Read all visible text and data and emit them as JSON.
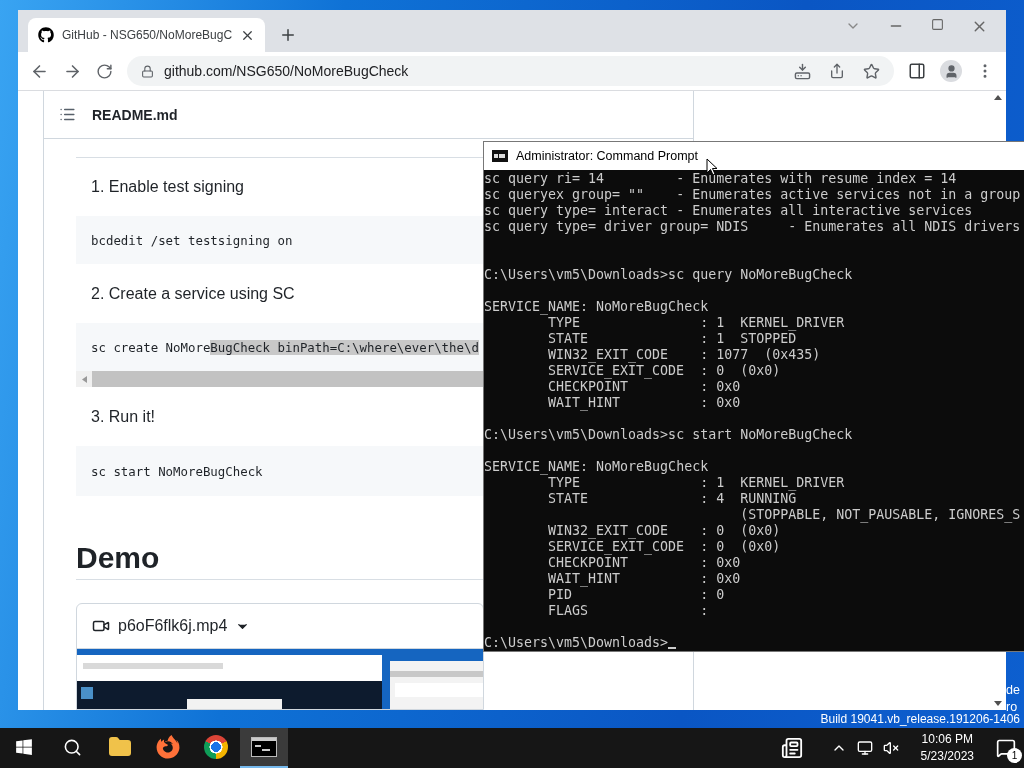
{
  "desktop": {
    "watermark": [
      "de",
      "ro"
    ],
    "build": "Build 19041.vb_release.191206-1406"
  },
  "browser": {
    "tabs": [
      {
        "title": "GitHub - NSG650/NoMoreBugC",
        "selected": true
      }
    ],
    "address": "github.com/NSG650/NoMoreBugCheck",
    "readme_header": "README.md",
    "steps": [
      {
        "kind": "text",
        "text": "1. Enable test signing"
      },
      {
        "kind": "code",
        "text": "bcdedit /set testsigning on"
      },
      {
        "kind": "text",
        "text": "2. Create a service using SC"
      },
      {
        "kind": "code",
        "text": "sc create NoMore",
        "selected_text": "BugCheck binPath=C:\\where\\ever\\the\\d",
        "scrollbar": true
      },
      {
        "kind": "text",
        "text": "3. Run it!"
      },
      {
        "kind": "code",
        "text": "sc start NoMoreBugCheck"
      }
    ],
    "heading": "Demo",
    "video": {
      "filename": "p6oF6flk6j.mp4",
      "kind": "picture"
    }
  },
  "cmd": {
    "title": "Administrator:  Command Prompt",
    "blocks": [
      [
        {
          "kind": "line",
          "text": "sc query ri= 14         - Enumerates with resume index = 14"
        },
        {
          "kind": "line",
          "text": "sc queryex group= \"\"    - Enumerates active services not in a group"
        },
        {
          "kind": "line",
          "text": "sc query type= interact - Enumerates all interactive services"
        },
        {
          "kind": "line",
          "text": "sc query type= driver group= NDIS     - Enumerates all NDIS drivers"
        }
      ],
      [
        {
          "kind": "line",
          "text": "C:\\Users\\vm5\\Downloads>sc query NoMoreBugCheck"
        }
      ],
      [
        {
          "kind": "line",
          "text": "SERVICE_NAME: NoMoreBugCheck"
        },
        {
          "kind": "field",
          "text": "TYPE               : 1  KERNEL_DRIVER"
        },
        {
          "kind": "field",
          "text": "STATE              : 1  STOPPED"
        },
        {
          "kind": "field",
          "text": "WIN32_EXIT_CODE    : 1077  (0x435)"
        },
        {
          "kind": "field",
          "text": "SERVICE_EXIT_CODE  : 0  (0x0)"
        },
        {
          "kind": "field",
          "text": "CHECKPOINT         : 0x0"
        },
        {
          "kind": "field",
          "text": "WAIT_HINT          : 0x0"
        }
      ],
      [
        {
          "kind": "line",
          "text": "C:\\Users\\vm5\\Downloads>sc start NoMoreBugCheck"
        }
      ],
      [
        {
          "kind": "line",
          "text": "SERVICE_NAME: NoMoreBugCheck"
        },
        {
          "kind": "field",
          "text": "TYPE               : 1  KERNEL_DRIVER"
        },
        {
          "kind": "field",
          "text": "STATE              : 4  RUNNING"
        },
        {
          "kind": "cont",
          "text": "(STOPPABLE, NOT_PAUSABLE, IGNORES_S"
        },
        {
          "kind": "field",
          "text": "WIN32_EXIT_CODE    : 0  (0x0)"
        },
        {
          "kind": "field",
          "text": "SERVICE_EXIT_CODE  : 0  (0x0)"
        },
        {
          "kind": "field",
          "text": "CHECKPOINT         : 0x0"
        },
        {
          "kind": "field",
          "text": "WAIT_HINT          : 0x0"
        },
        {
          "kind": "field",
          "text": "PID                : 0"
        },
        {
          "kind": "field",
          "text": "FLAGS              :"
        }
      ],
      [
        {
          "kind": "line",
          "text": "C:\\Users\\vm5\\Downloads>",
          "cursor": true
        }
      ]
    ]
  },
  "taskbar": {
    "apps": [
      {
        "kind": "explorer",
        "selected": false
      },
      {
        "kind": "firefox",
        "selected": false
      },
      {
        "kind": "chrome",
        "selected": false
      },
      {
        "kind": "terminal",
        "selected": true
      }
    ],
    "time": "10:06 PM",
    "date": "5/23/2023",
    "notifications": "1"
  }
}
